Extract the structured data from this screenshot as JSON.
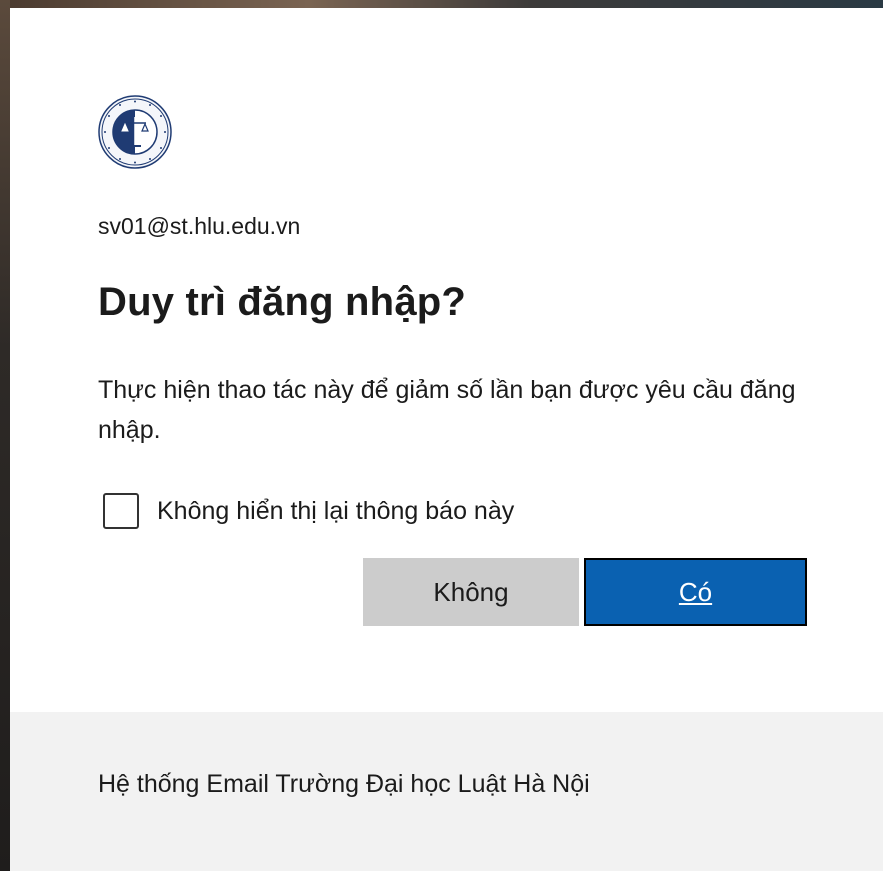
{
  "dialog": {
    "account_email": "sv01@st.hlu.edu.vn",
    "title": "Duy trì đăng nhập?",
    "description": "Thực hiện thao tác này để giảm số lần bạn được yêu cầu đăng nhập.",
    "dont_show_again_label": "Không hiển thị lại thông báo này",
    "dont_show_again_checked": false,
    "no_button_label": "Không",
    "yes_button_label": "Có",
    "logo_icon": "university-seal-logo"
  },
  "footer": {
    "text": "Hệ thống Email Trường Đại học Luật Hà Nội"
  },
  "colors": {
    "primary_button": "#0a61b1",
    "secondary_button": "#cccccc",
    "footer_background": "#f2f2f2"
  }
}
